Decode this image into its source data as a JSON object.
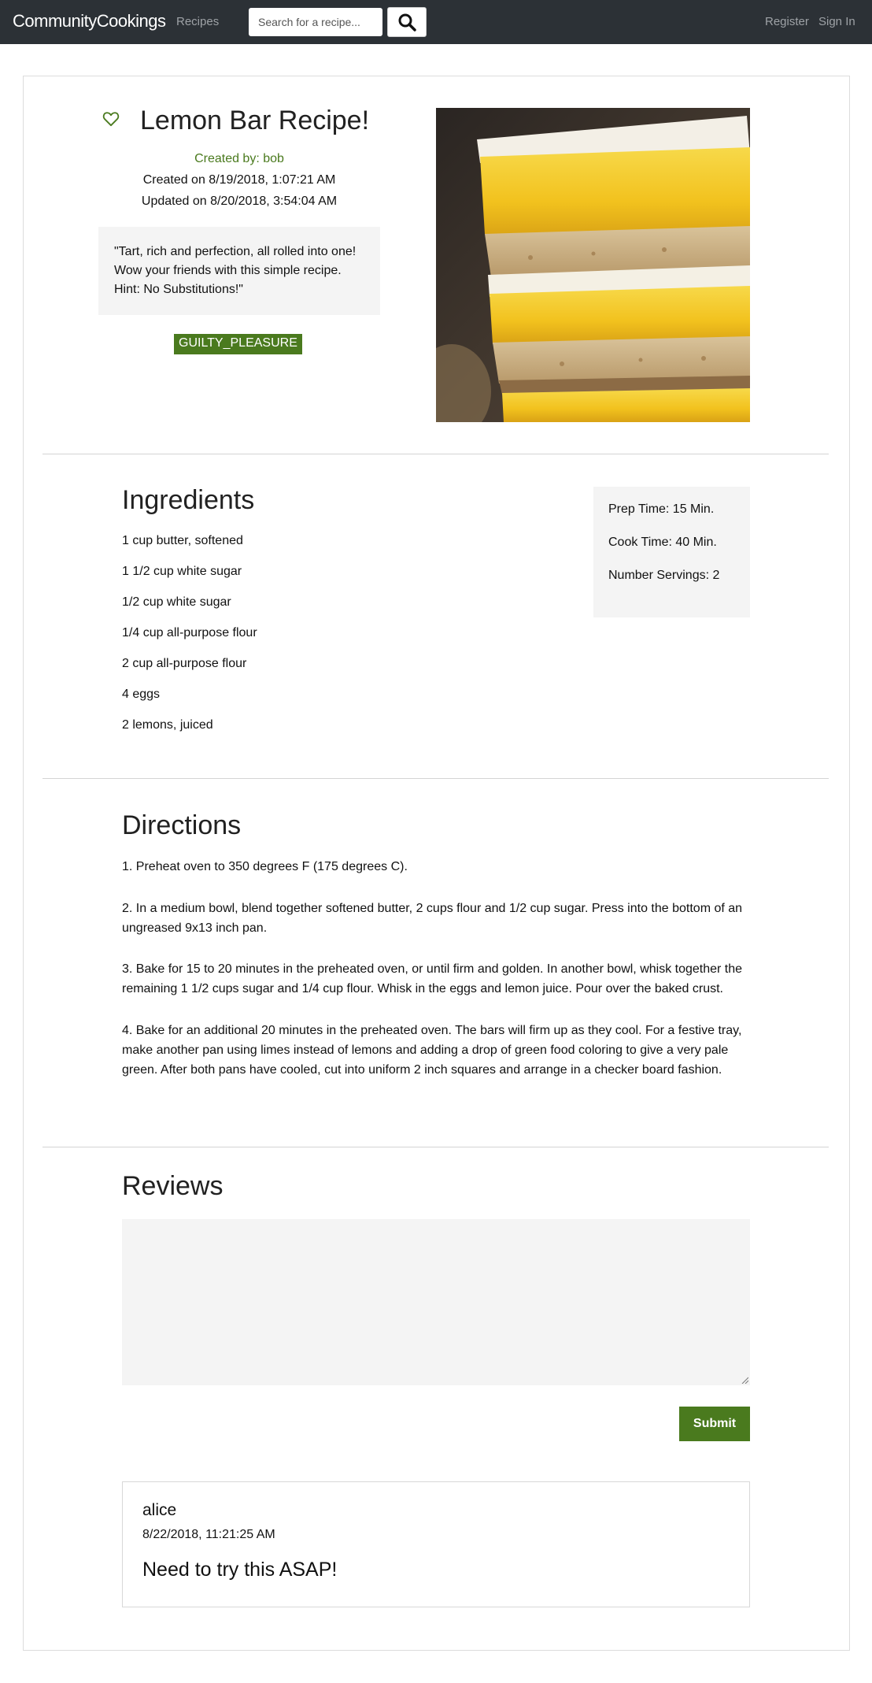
{
  "navbar": {
    "brand": "CommunityCookings",
    "recipes_link": "Recipes",
    "search_placeholder": "Search for a recipe...",
    "register_link": "Register",
    "signin_link": "Sign In"
  },
  "recipe": {
    "title": "Lemon Bar Recipe!",
    "created_by": "Created by: bob",
    "created_on": "Created on 8/19/2018, 1:07:21 AM",
    "updated_on": "Updated on 8/20/2018, 3:54:04 AM",
    "description_lines": [
      "\"Tart, rich and perfection, all rolled into one!",
      "Wow your friends with this simple recipe.",
      "Hint: No Substitutions!\""
    ],
    "tag": "GUILTY_PLEASURE",
    "image_icon": "lemon-bar-photo"
  },
  "ingredients": {
    "heading": "Ingredients",
    "items": [
      "1 cup butter, softened",
      "1 1/2 cup white sugar",
      "1/2 cup white sugar",
      "1/4 cup all-purpose flour",
      "2 cup all-purpose flour",
      "4 eggs",
      "2 lemons, juiced"
    ]
  },
  "timing": {
    "prep": "Prep Time: 15 Min.",
    "cook": "Cook Time: 40 Min.",
    "servings": "Number Servings: 2"
  },
  "directions": {
    "heading": "Directions",
    "steps": [
      "1. Preheat oven to 350 degrees F (175 degrees C).",
      "2. In a medium bowl, blend together softened butter, 2 cups flour and 1/2 cup sugar. Press into the bottom of an ungreased 9x13 inch pan.",
      "3. Bake for 15 to 20 minutes in the preheated oven, or until firm and golden. In another bowl, whisk together the remaining 1 1/2 cups sugar and 1/4 cup flour. Whisk in the eggs and lemon juice. Pour over the baked crust.",
      "4. Bake for an additional 20 minutes in the preheated oven. The bars will firm up as they cool. For a festive tray, make another pan using limes instead of lemons and adding a drop of green food coloring to give a very pale green. After both pans have cooled, cut into uniform 2 inch squares and arrange in a checker board fashion."
    ]
  },
  "reviews": {
    "heading": "Reviews",
    "input_value": "",
    "submit_label": "Submit",
    "items": [
      {
        "author": "alice",
        "date": "8/22/2018, 11:21:25 AM",
        "text": "Need to try this ASAP!"
      }
    ]
  },
  "colors": {
    "navbar_bg": "#2c3136",
    "accent_green": "#4a7a1e",
    "panel_bg": "#f4f4f4"
  },
  "icons": {
    "favorite": "heart-outline-icon",
    "search": "magnifier-icon"
  }
}
